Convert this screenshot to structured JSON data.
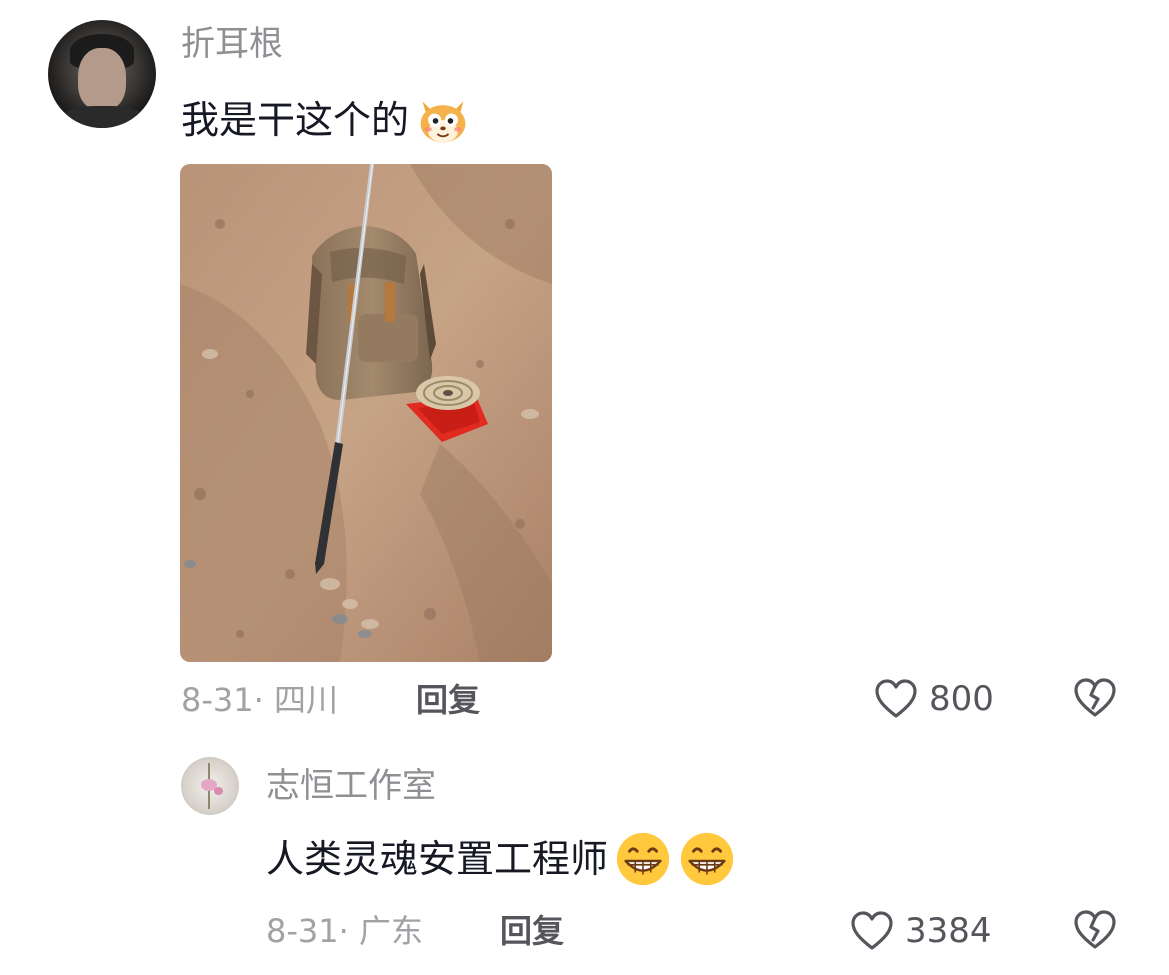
{
  "comment": {
    "username": "折耳根",
    "text": "我是干这个的",
    "emoji": "fox-face-emoji",
    "photo": "photo of backpack, metal probe pole and luopan compass on red cloth on dirt ground",
    "date": "8-31",
    "location": "四川",
    "reply_label": "回复",
    "likes": "800"
  },
  "reply": {
    "username": "志恒工作室",
    "text": "人类灵魂安置工程师",
    "emoji": "grinning-face-emoji",
    "date": "8-31",
    "location": "广东",
    "reply_label": "回复",
    "likes": "3384"
  },
  "colors": {
    "username": "#8f8f94",
    "text": "#161823",
    "meta": "#a1a1a6",
    "action": "#55565c"
  }
}
